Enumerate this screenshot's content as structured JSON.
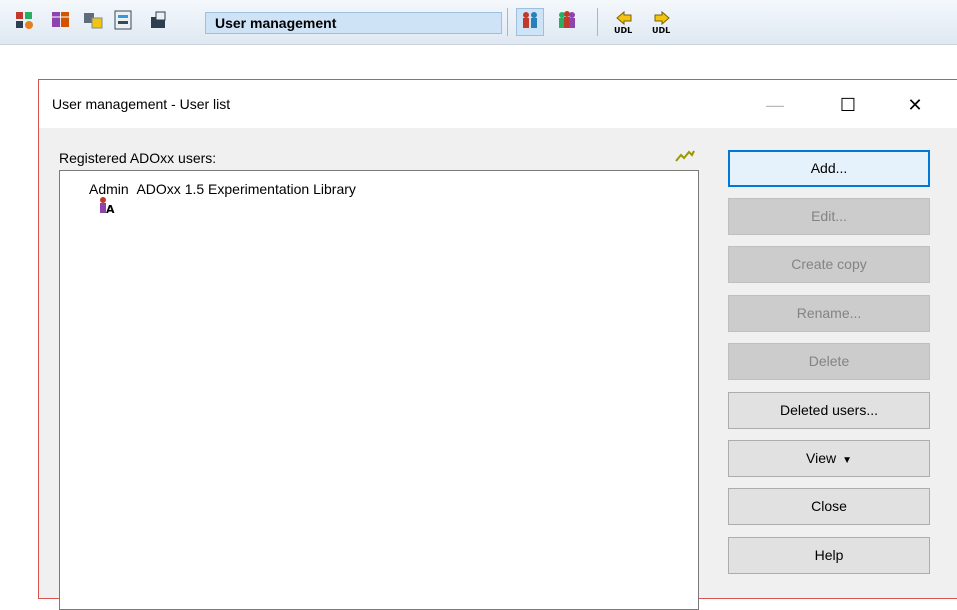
{
  "toolbar": {
    "module_title": "User management",
    "icons": [
      "acquisition-icon",
      "modelling-icon",
      "analysis-icon",
      "simulation-icon",
      "import-export-icon",
      "users-icon",
      "user-groups-icon",
      "udl-import-icon",
      "udl-export-icon"
    ],
    "udl_label": "UDL"
  },
  "dialog": {
    "title": "User management - User list",
    "minimize": "—",
    "maximize": "☐",
    "close": "✕"
  },
  "users": {
    "label": "Registered ADOxx users:",
    "items": [
      {
        "name": "Admin",
        "library": "ADOxx 1.5 Experimentation Library"
      }
    ]
  },
  "buttons": {
    "add": "Add...",
    "edit": "Edit...",
    "create_copy": "Create copy",
    "rename": "Rename...",
    "delete": "Delete",
    "deleted_users": "Deleted users...",
    "view": "View",
    "close": "Close",
    "help": "Help"
  },
  "colors": {
    "accent": "#0078d7",
    "dialog_border": "#d9534f",
    "toolbar_field": "#cfe3f7"
  }
}
